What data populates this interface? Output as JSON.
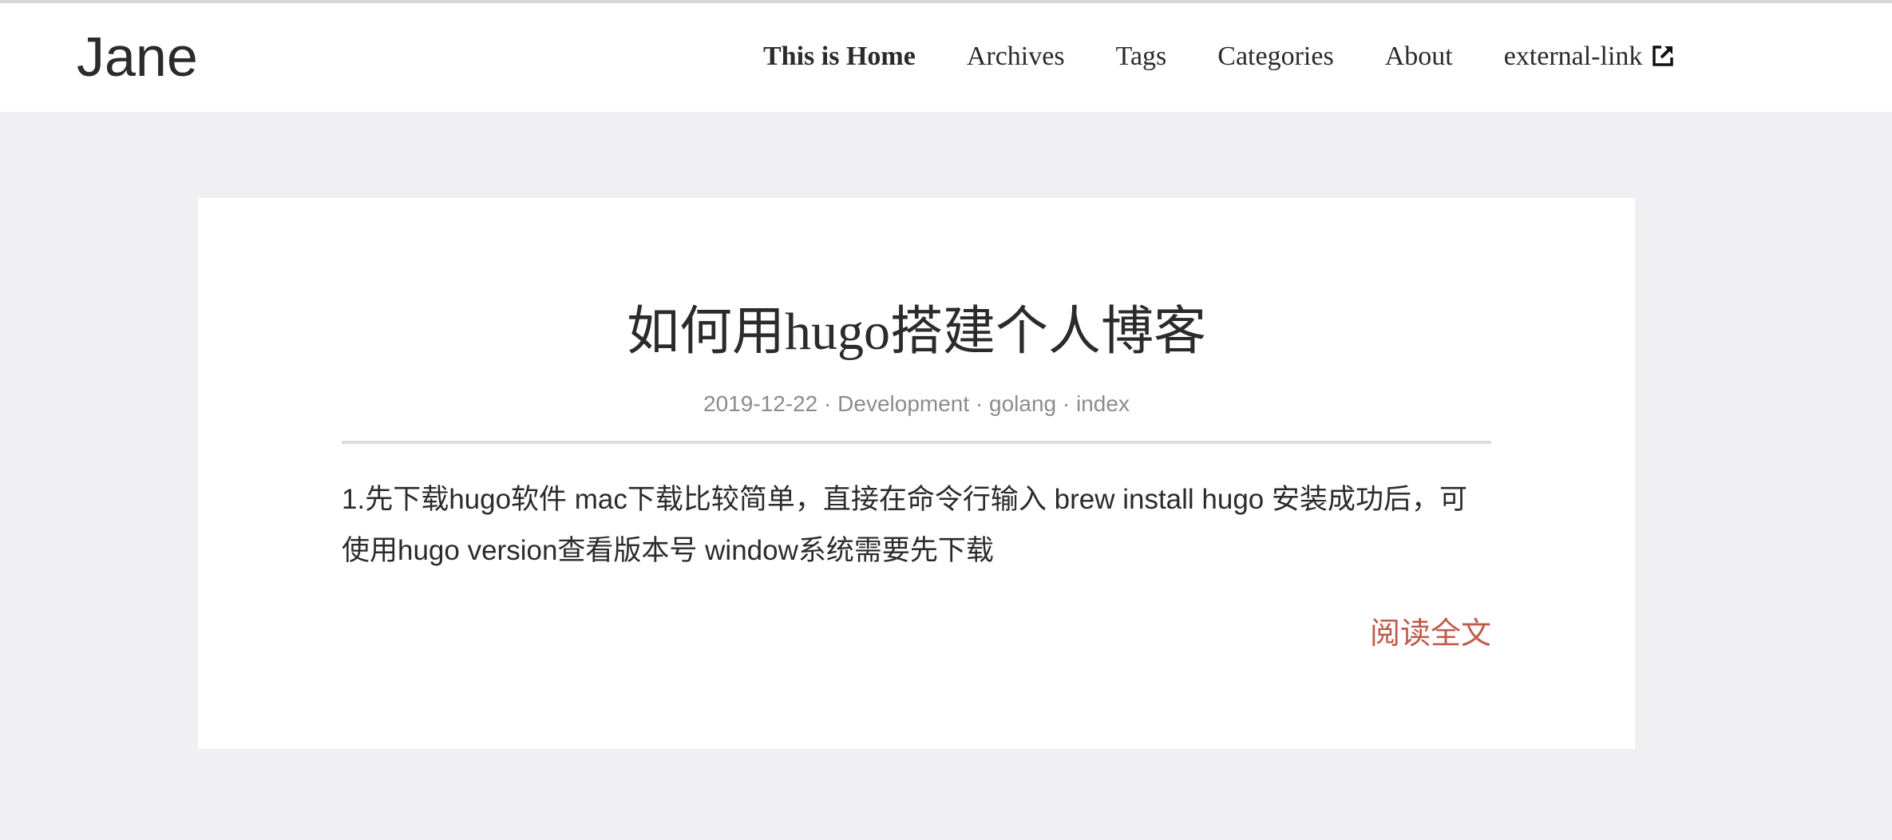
{
  "site": {
    "logo": "Jane"
  },
  "nav": {
    "items": [
      {
        "label": "This is Home"
      },
      {
        "label": "Archives"
      },
      {
        "label": "Tags"
      },
      {
        "label": "Categories"
      },
      {
        "label": "About"
      },
      {
        "label": "external-link",
        "icon": "external-link-icon"
      }
    ]
  },
  "post": {
    "title": "如何用hugo搭建个人博客",
    "meta": {
      "date": "2019-12-22",
      "separator": " · ",
      "category": "Development",
      "tags": [
        "golang",
        "index"
      ]
    },
    "summary": "1.先下载hugo软件 mac下载比较简单，直接在命令行输入 brew install hugo 安装成功后，可使用hugo version查看版本号 window系统需要先下载",
    "read_more": "阅读全文"
  },
  "colors": {
    "background": "#f0f0f2",
    "card": "#ffffff",
    "text": "#2b2b2b",
    "meta": "#8c8c8c",
    "accent": "#c05b4d"
  }
}
